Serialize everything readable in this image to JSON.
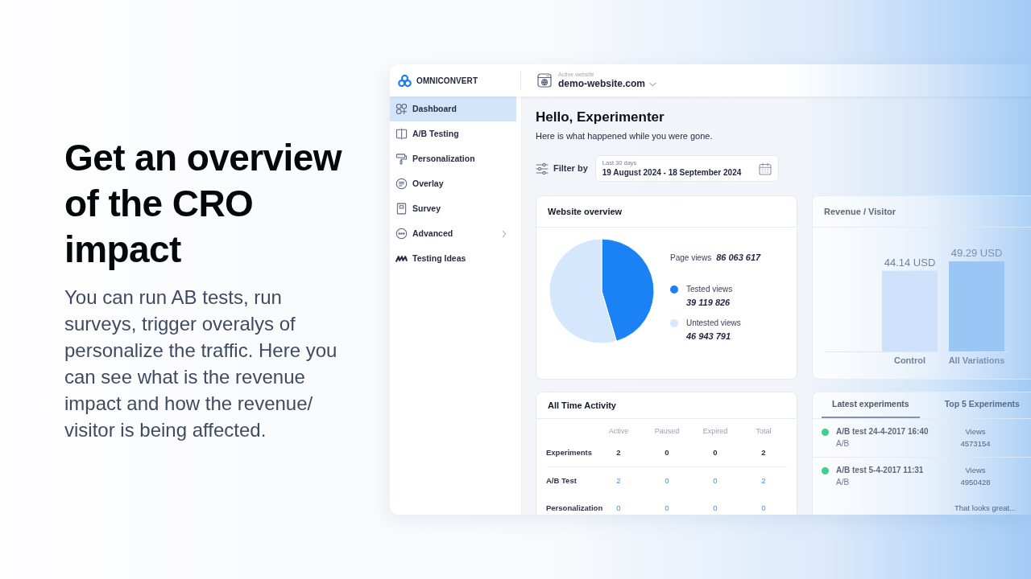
{
  "intro": {
    "title": "Get an overview of the CRO impact",
    "text": "You can run AB tests, run surveys, trigger overalys of personalize the traffic. Here you can see what is the revenue impact and how the revenue/ visitor is being affected."
  },
  "header": {
    "brand": "OMNICONVERT",
    "site_label": "Active website",
    "site": "demo-website.com"
  },
  "sidebar": {
    "items": [
      {
        "label": "Dashboard",
        "kind": "link",
        "selected": true
      },
      {
        "label": "A/B Testing",
        "kind": "link",
        "selected": false
      },
      {
        "label": "Personalization",
        "kind": "link",
        "selected": false
      },
      {
        "label": "Overlay",
        "kind": "link",
        "selected": false
      },
      {
        "label": "Survey",
        "kind": "link",
        "selected": false
      },
      {
        "label": "Advanced",
        "kind": "submenu",
        "selected": false
      },
      {
        "label": "Testing Ideas",
        "kind": "link",
        "selected": false
      }
    ]
  },
  "main": {
    "title": "Hello, Experimenter",
    "subtitle": "Here is what happened while you were gone.",
    "filter": {
      "label": "Filter by",
      "range_label": "Last 30 days",
      "range": "19 August 2024 - 18 September 2024"
    }
  },
  "website_overview": {
    "title": "Website overview",
    "page_views_label": "Page views",
    "page_views": "86 063 617",
    "chart_data": {
      "type": "pie",
      "categories": [
        "Tested views",
        "Untested views"
      ],
      "values": [
        45.45,
        54.55
      ]
    },
    "legend": [
      {
        "value": "39 119 826",
        "color": "#1a82f5"
      },
      {
        "value": "46 943 791",
        "color": "#d5e7fc"
      }
    ]
  },
  "revenue_per_visitor": {
    "title": "Revenue / Visitor",
    "chart_data": {
      "type": "bar",
      "categories": [
        "Control",
        "All Variations"
      ],
      "values": [
        44.14,
        49.29
      ],
      "value_labels": [
        "44.14 USD",
        "49.29 USD"
      ]
    },
    "bars": [
      {
        "color": "#cde2fa"
      },
      {
        "color": "#9ac6f6"
      }
    ]
  },
  "all_time_activity": {
    "title": "All Time Activity",
    "columns": [
      "Active",
      "Paused",
      "Expired",
      "Total"
    ],
    "rows": [
      {
        "label": "Experiments",
        "kind": "total",
        "cells": [
          "2",
          "0",
          "0",
          "2"
        ]
      },
      {
        "label": "A/B Test",
        "kind": "link",
        "cells": [
          "2",
          "0",
          "0",
          "2"
        ]
      },
      {
        "label": "Personalization",
        "kind": "link",
        "cells": [
          "0",
          "0",
          "0",
          "0"
        ]
      }
    ]
  },
  "latest_experiments": {
    "tabs": [
      {
        "label": "Latest experiments",
        "selected": true
      },
      {
        "label": "Top 5 Experiments",
        "selected": false
      }
    ],
    "items": [
      {
        "name": "A/B test 24-4-2017 16:40",
        "type": "A/B",
        "color": "#3ecf8e",
        "views_label": "Views",
        "views": "4573154"
      },
      {
        "name": "A/B test 5-4-2017 11:31",
        "type": "A/B",
        "color": "#3ecf8e",
        "views_label": "Views",
        "views": "4950428"
      }
    ],
    "footer": "That looks great..."
  }
}
